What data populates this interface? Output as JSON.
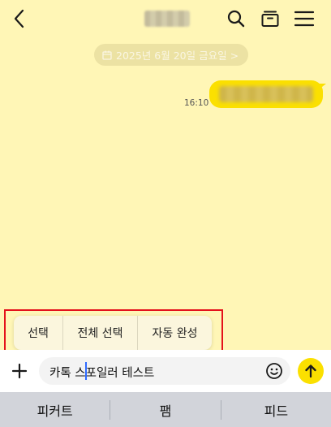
{
  "header": {
    "back_icon": "chevron-left-icon",
    "title_redacted": true,
    "icons": [
      "search-icon",
      "archive-icon",
      "menu-icon"
    ]
  },
  "date_divider": {
    "icon": "calendar-icon",
    "label": "2025년 6월 20일 금요일 >"
  },
  "messages": [
    {
      "sender": "me",
      "text_redacted": true,
      "time": "16:10",
      "bubble_color": "#FBE000"
    }
  ],
  "context_menu": {
    "items": [
      "선택",
      "전체 선택",
      "자동 완성"
    ],
    "highlight_color": "#E4121B"
  },
  "input_bar": {
    "plus_icon": "plus-icon",
    "value": "카톡 스포일러 테스트",
    "emoji_icon": "emoji-icon",
    "send_icon": "arrow-up-icon",
    "send_color": "#FBE000"
  },
  "keyboard_suggestions": [
    "피커트",
    "팸",
    "피드"
  ],
  "colors": {
    "chat_background": "#FFF6B6",
    "accent": "#FBE000"
  }
}
